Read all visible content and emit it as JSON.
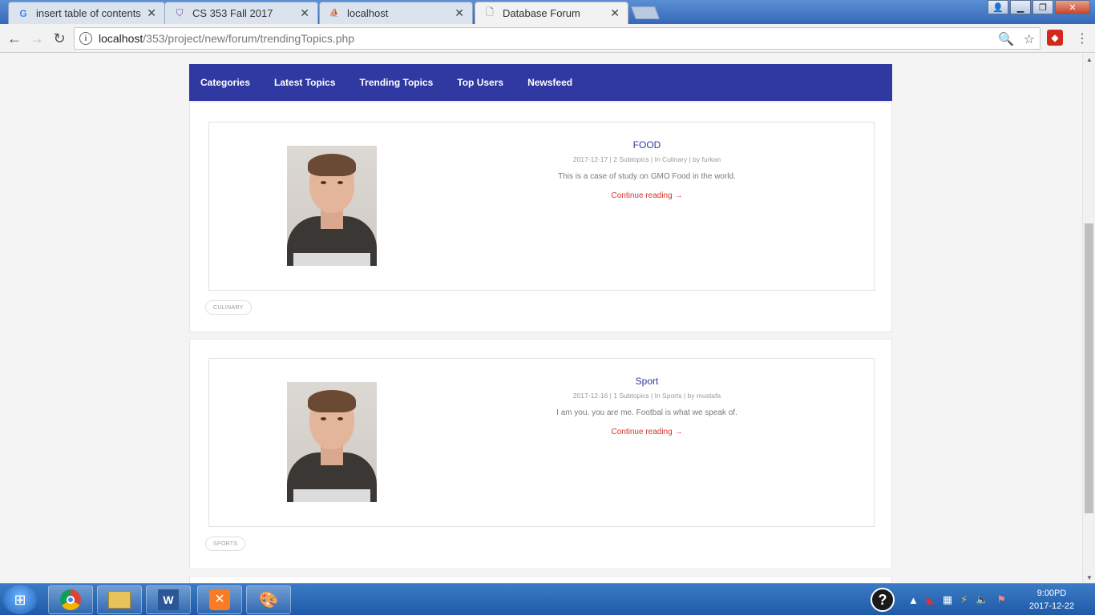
{
  "browser": {
    "tabs": [
      {
        "title": "insert table of contents w",
        "icon": "google-icon",
        "active": false
      },
      {
        "title": "CS 353 Fall 2017",
        "icon": "shield-icon",
        "active": false
      },
      {
        "title": "localhost",
        "icon": "phpmyadmin-icon",
        "active": false
      },
      {
        "title": "Database Forum",
        "icon": "page-icon",
        "active": true
      }
    ],
    "url_host": "localhost",
    "url_path": "/353/project/new/forum/trendingTopics.php"
  },
  "nav": {
    "items": [
      "Categories",
      "Latest Topics",
      "Trending Topics",
      "Top Users",
      "Newsfeed"
    ]
  },
  "posts": [
    {
      "title": "FOOD",
      "meta": "2017-12-17 |  2 Subtopics |  In Culinary |  by furkan",
      "excerpt": "This is a case of study on GMO Food in the world.",
      "more": "Continue reading →",
      "tag": "CULINARY"
    },
    {
      "title": "Sport",
      "meta": "2017-12-16 |  1 Subtopics |  In Sports |  by mustafa",
      "excerpt": "I am you. you are me. Footbal is what we speak of.",
      "more": "Continue reading →",
      "tag": "SPORTS"
    }
  ],
  "taskbar": {
    "time": "9:00PD",
    "date": "2017-12-22"
  },
  "colors": {
    "nav_bg": "#3039a2",
    "title": "#2e3a9f",
    "link": "#d0342c"
  }
}
